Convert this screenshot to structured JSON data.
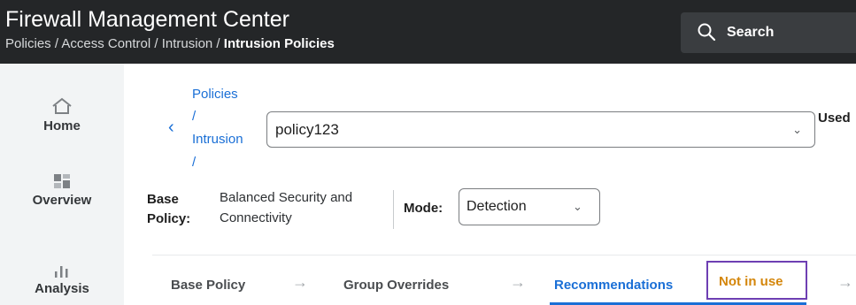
{
  "header": {
    "title": "Firewall Management Center",
    "breadcrumb": {
      "path": "Policies / Access Control / Intrusion / ",
      "current": "Intrusion Policies"
    },
    "search_label": "Search"
  },
  "sidebar": {
    "items": [
      {
        "label": "Home",
        "icon": "home-icon"
      },
      {
        "label": "Overview",
        "icon": "dashboard-icon"
      },
      {
        "label": "Analysis",
        "icon": "bar-chart-icon"
      }
    ]
  },
  "policy_header": {
    "back_path": [
      "Policies",
      "/",
      "Intrusion",
      "/"
    ],
    "policy_name": "policy123",
    "used_label": "Used"
  },
  "base_policy": {
    "key_line1": "Base",
    "key_line2": "Policy:",
    "value_line1": "Balanced Security and",
    "value_line2": "Connectivity"
  },
  "mode": {
    "label": "Mode:",
    "value": "Detection"
  },
  "tabs": [
    {
      "label": "Base Policy",
      "active": false
    },
    {
      "label": "Group Overrides",
      "active": false
    },
    {
      "label": "Recommendations",
      "active": true
    }
  ],
  "recommendation_status": "Not in use",
  "arrow_glyph": "→",
  "colors": {
    "accent": "#1a6fd6",
    "status": "#d4860b",
    "highlight": "#6e3fb3",
    "header_bg": "#242628"
  }
}
